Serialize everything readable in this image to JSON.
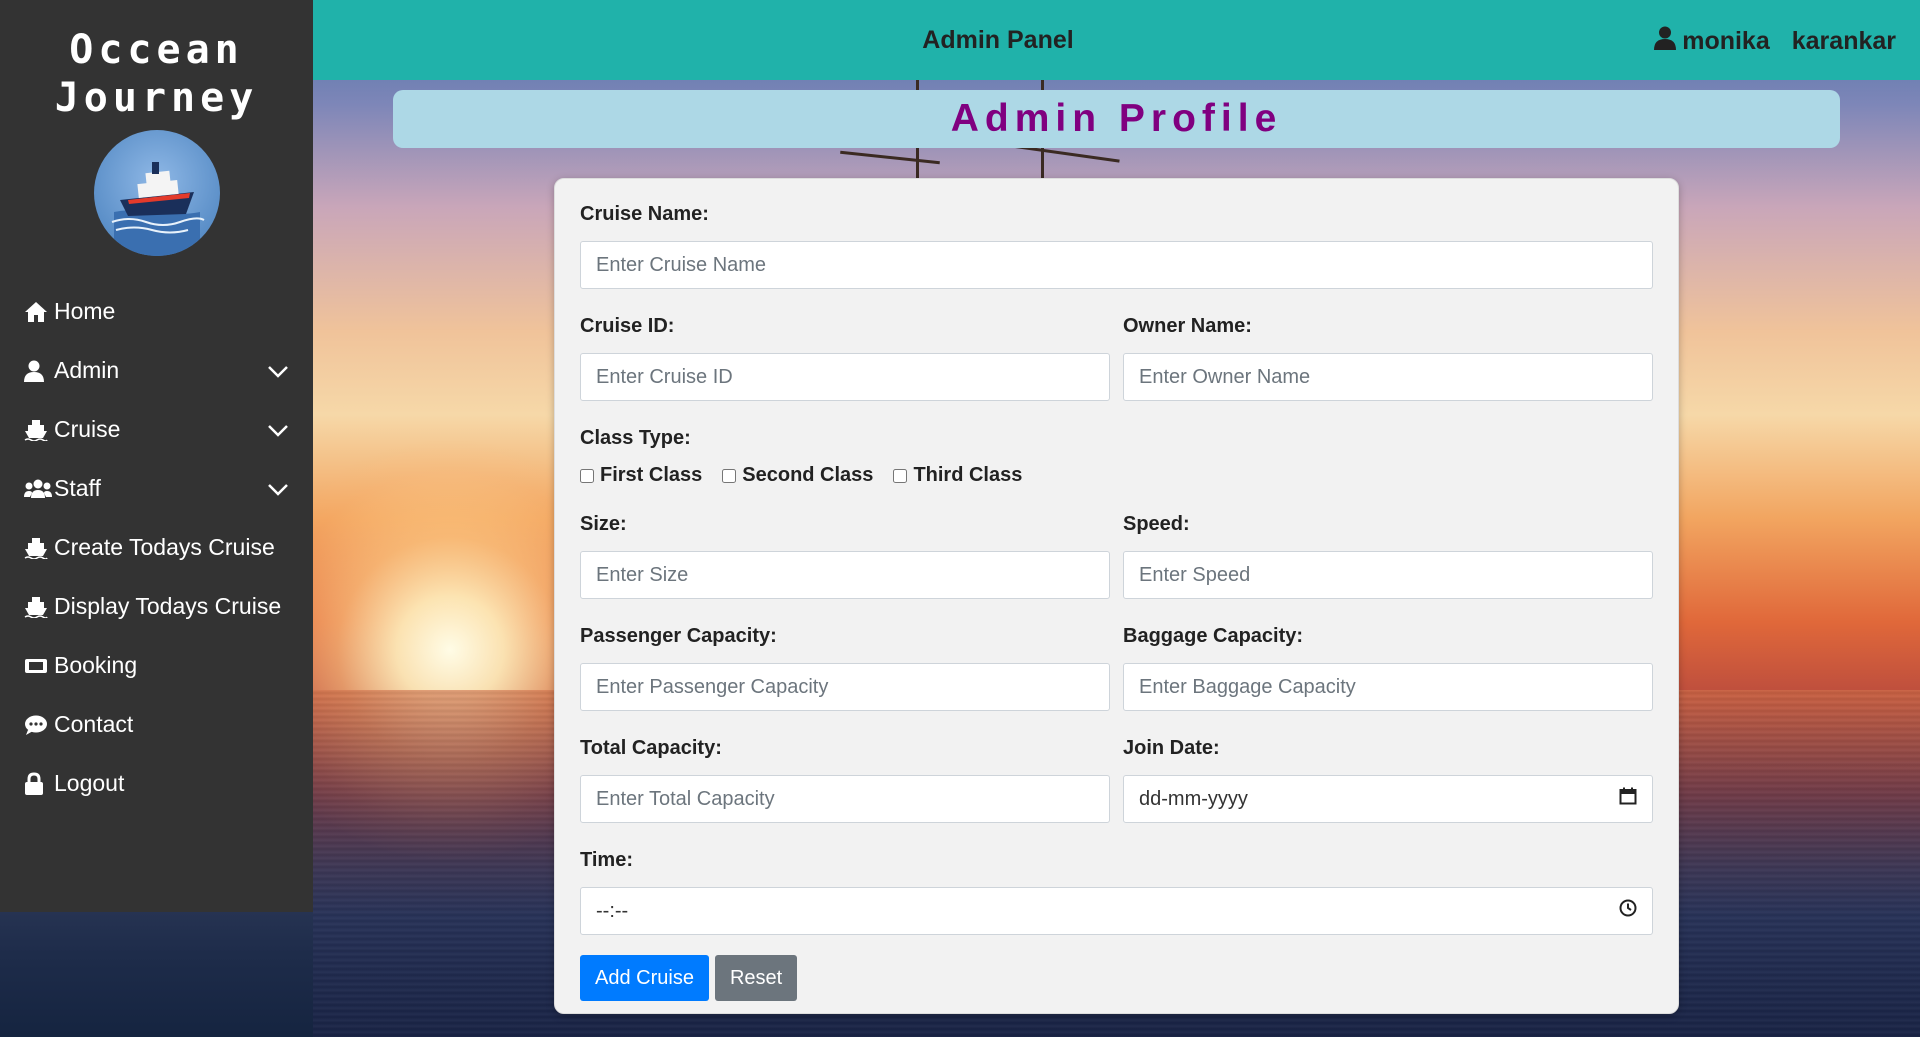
{
  "sidebar": {
    "brand_line1": "Occean",
    "brand_line2": "Journey",
    "items": [
      {
        "label": "Home",
        "icon": "home-icon"
      },
      {
        "label": "Admin",
        "icon": "user-icon"
      },
      {
        "label": "Cruise",
        "icon": "ship-icon"
      },
      {
        "label": "Staff",
        "icon": "users-icon"
      },
      {
        "label": "Create Todays Cruise",
        "icon": "ship-icon"
      },
      {
        "label": "Display Todays Cruise",
        "icon": "ship-icon"
      },
      {
        "label": "Booking",
        "icon": "ticket-icon"
      },
      {
        "label": "Contact",
        "icon": "chat-icon"
      },
      {
        "label": "Logout",
        "icon": "lock-icon"
      }
    ]
  },
  "header": {
    "title": "Admin Panel",
    "user_first": "monika",
    "user_last": "karankar"
  },
  "profile_title": "Admin Profile",
  "form": {
    "cruise_name": {
      "label": "Cruise Name:",
      "placeholder": "Enter Cruise Name"
    },
    "cruise_id": {
      "label": "Cruise ID:",
      "placeholder": "Enter Cruise ID"
    },
    "owner_name": {
      "label": "Owner Name:",
      "placeholder": "Enter Owner Name"
    },
    "class_type": {
      "label": "Class Type:",
      "options": [
        "First Class",
        "Second Class",
        "Third Class"
      ]
    },
    "size": {
      "label": "Size:",
      "placeholder": "Enter Size"
    },
    "speed": {
      "label": "Speed:",
      "placeholder": "Enter Speed"
    },
    "passenger_capacity": {
      "label": "Passenger Capacity:",
      "placeholder": "Enter Passenger Capacity"
    },
    "baggage_capacity": {
      "label": "Baggage Capacity:",
      "placeholder": "Enter Baggage Capacity"
    },
    "total_capacity": {
      "label": "Total Capacity:",
      "placeholder": "Enter Total Capacity"
    },
    "join_date": {
      "label": "Join Date:",
      "value": "dd-mm-yyyy"
    },
    "time": {
      "label": "Time:",
      "value": "--:--"
    },
    "add_button": "Add Cruise",
    "reset_button": "Reset"
  },
  "colors": {
    "sidebar_bg": "#333333",
    "header_bg": "#20b2aa",
    "profile_bar_bg": "#add8e6",
    "profile_title": "#800080",
    "primary": "#007bff",
    "secondary": "#6c757d"
  }
}
